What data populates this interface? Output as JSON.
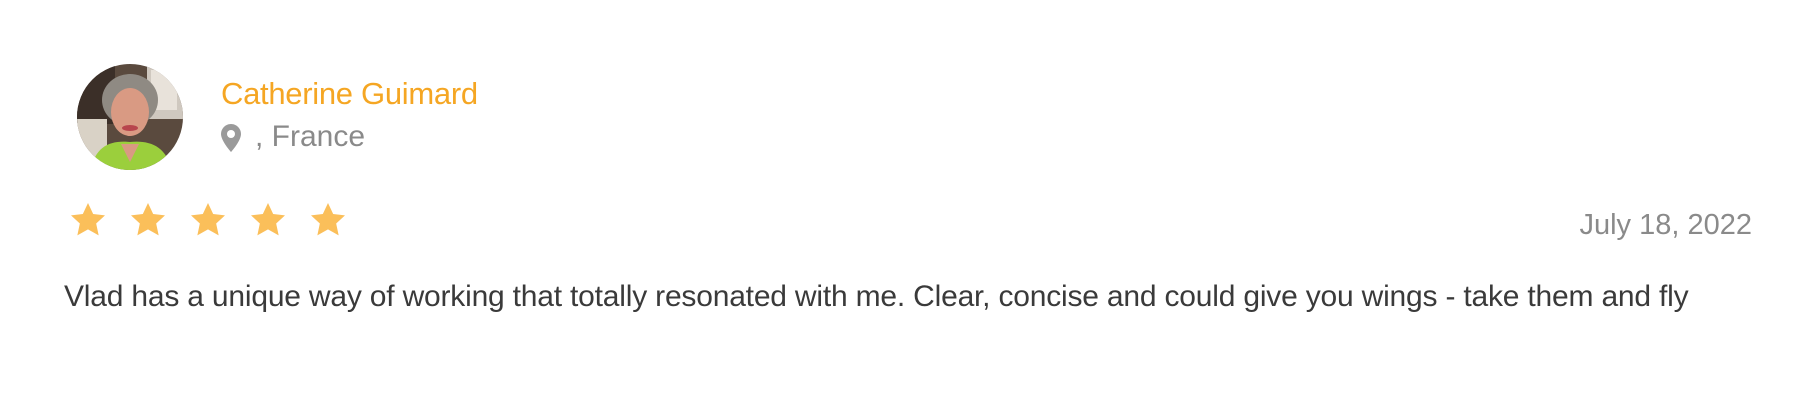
{
  "review": {
    "reviewer": {
      "name": "Catherine Guimard",
      "location": ", France",
      "avatar_alt": "avatar"
    },
    "rating": {
      "value": 5,
      "max": 5
    },
    "date": "July 18, 2022",
    "text": "Vlad has a unique way of working that totally resonated with me. Clear, concise and could give you wings - take them and fly"
  },
  "colors": {
    "accent": "#f5a623",
    "star": "#fbbf5a",
    "muted": "#8a8a8a",
    "body_text": "#3a3a3a"
  },
  "icons": {
    "location": "map-pin-icon",
    "star": "star-icon"
  }
}
